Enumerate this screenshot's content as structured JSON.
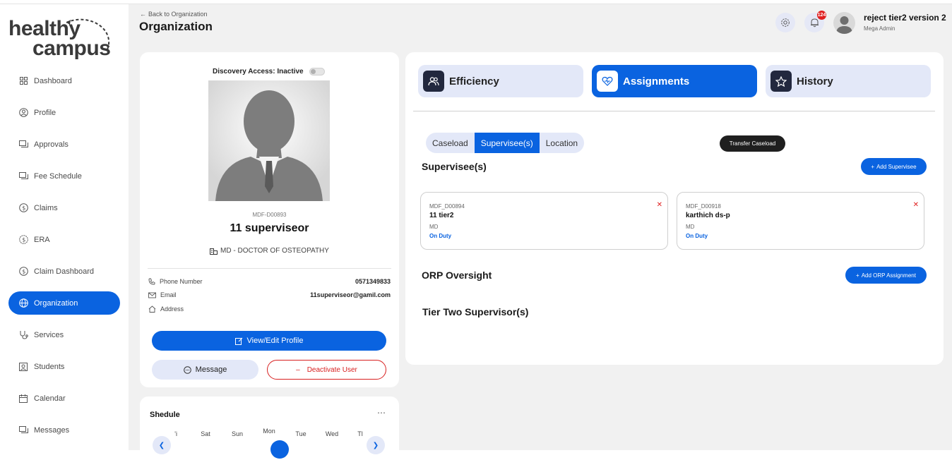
{
  "brand": {
    "line1": "healthy",
    "line2": "campus"
  },
  "sidebar": {
    "items": [
      {
        "label": "Dashboard",
        "icon": "grid-icon"
      },
      {
        "label": "Profile",
        "icon": "user-circle-icon"
      },
      {
        "label": "Approvals",
        "icon": "chat-icon"
      },
      {
        "label": "Fee Schedule",
        "icon": "chat-icon"
      },
      {
        "label": "Claims",
        "icon": "dollar-icon"
      },
      {
        "label": "ERA",
        "icon": "gear-dollar-icon"
      },
      {
        "label": "Claim Dashboard",
        "icon": "dollar-icon"
      },
      {
        "label": "Organization",
        "icon": "globe-icon",
        "active": true
      },
      {
        "label": "Services",
        "icon": "stethoscope-icon"
      },
      {
        "label": "Students",
        "icon": "id-card-icon"
      },
      {
        "label": "Calendar",
        "icon": "calendar-icon"
      },
      {
        "label": "Messages",
        "icon": "chat-icon"
      }
    ]
  },
  "header": {
    "back_label": "Back to Organization",
    "title": "Organization",
    "notification_count": "124",
    "user_name": "reject tier2 version 2",
    "user_role": "Mega Admin"
  },
  "profile": {
    "discovery_label": "Discovery Access: Inactive",
    "id": "MDF-D00893",
    "name": "11 superviseor",
    "degree": "MD - DOCTOR OF OSTEOPATHY",
    "phone_label": "Phone Number",
    "phone_value": "0571349833",
    "email_label": "Email",
    "email_value": "11superviseor@gamil.com",
    "address_label": "Address",
    "edit_label": "View/Edit Profile",
    "message_label": "Message",
    "deactivate_label": "Deactivate User"
  },
  "schedule": {
    "title": "Shedule",
    "days": [
      "’i",
      "Sat",
      "Sun",
      "Mon",
      "Tue",
      "Wed",
      "Tl"
    ]
  },
  "tabs": [
    {
      "label": "Efficiency",
      "icon": "users-icon"
    },
    {
      "label": "Assignments",
      "icon": "heart-icon",
      "active": true
    },
    {
      "label": "History",
      "icon": "star-icon"
    }
  ],
  "segments": [
    "Caseload",
    "Supervisee(s)",
    "Location"
  ],
  "transfer_label": "Transfer Caseload",
  "supervisees": {
    "title": "Supervisee(s)",
    "add_label": "Add Supervisee",
    "items": [
      {
        "id": "MDF_D00894",
        "name": "11 tier2",
        "degree": "MD",
        "status": "On Duty"
      },
      {
        "id": "MDF_D00918",
        "name": "karthich ds-p",
        "degree": "MD",
        "status": "On Duty"
      }
    ]
  },
  "orp": {
    "title": "ORP Oversight",
    "add_label": "Add ORP Assignment"
  },
  "tier_two": {
    "title": "Tier Two Supervisor(s)"
  },
  "colors": {
    "accent": "#0a63e0",
    "danger": "#d82020",
    "dark": "#22283e"
  }
}
